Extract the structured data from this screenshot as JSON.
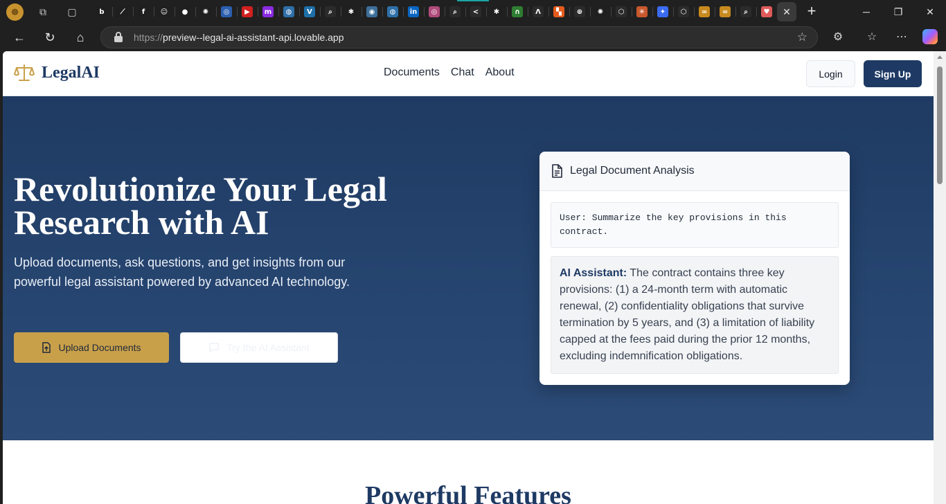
{
  "browser": {
    "url_protocol": "https://",
    "url_host": "preview--legal-ai-assistant-api.lovable.app",
    "tabs": [
      {
        "icon": "b-icon",
        "glyph": "b",
        "color": "#1f1f1f"
      },
      {
        "icon": "trend-icon",
        "glyph": "⟋",
        "color": "#1f1f1f"
      },
      {
        "icon": "f-icon",
        "glyph": "f",
        "color": "#1f1f1f"
      },
      {
        "icon": "robot-icon",
        "glyph": "☺",
        "color": "#1f1f1f"
      },
      {
        "icon": "github-icon",
        "glyph": "●",
        "color": "#1f1f1f"
      },
      {
        "icon": "openai-icon",
        "glyph": "✺",
        "color": "#1f1f1f"
      },
      {
        "icon": "blue-circle-icon",
        "glyph": "◎",
        "color": "#2b5fb0"
      },
      {
        "icon": "youtube-icon",
        "glyph": "▶",
        "color": "#d02020"
      },
      {
        "icon": "m-icon",
        "glyph": "m",
        "color": "#8a2be2"
      },
      {
        "icon": "un-icon",
        "glyph": "◍",
        "color": "#2e6fa8"
      },
      {
        "icon": "v-icon",
        "glyph": "V",
        "color": "#1e6fa8"
      },
      {
        "icon": "search-icon",
        "glyph": "⌕",
        "color": "#2b2b2b"
      },
      {
        "icon": "bug-icon",
        "glyph": "✱",
        "color": "#1f1f1f"
      },
      {
        "icon": "globe-icon",
        "glyph": "◉",
        "color": "#3d6f99"
      },
      {
        "icon": "un-icon",
        "glyph": "◍",
        "color": "#2e6fa8"
      },
      {
        "icon": "linkedin-icon",
        "glyph": "in",
        "color": "#0a66c2"
      },
      {
        "icon": "pink-circle-icon",
        "glyph": "◎",
        "color": "#b04a7a"
      },
      {
        "icon": "search-icon",
        "glyph": "⌕",
        "color": "#2b2b2b"
      },
      {
        "icon": "share-icon",
        "glyph": "<",
        "color": "#2b2b2b"
      },
      {
        "icon": "bug-icon",
        "glyph": "✱",
        "color": "#1f1f1f"
      },
      {
        "icon": "arc-icon",
        "glyph": "∩",
        "color": "#2e7d32"
      },
      {
        "icon": "caret-icon",
        "glyph": "Λ",
        "color": "#2b2b2b"
      },
      {
        "icon": "grid-icon",
        "glyph": "▚",
        "color": "#e55b1c"
      },
      {
        "icon": "web-icon",
        "glyph": "⊕",
        "color": "#2b2b2b"
      },
      {
        "icon": "openai-icon",
        "glyph": "✺",
        "color": "#1f1f1f"
      },
      {
        "icon": "box-icon",
        "glyph": "⬡",
        "color": "#2b2b2b"
      },
      {
        "icon": "claude-icon",
        "glyph": "✳",
        "color": "#c8582d"
      },
      {
        "icon": "gemini-icon",
        "glyph": "✦",
        "color": "#3b6cf0"
      },
      {
        "icon": "box-icon",
        "glyph": "⬡",
        "color": "#2b2b2b"
      },
      {
        "icon": "infinity-icon",
        "glyph": "∞",
        "color": "#c78a1e"
      },
      {
        "icon": "infinity-icon",
        "glyph": "∞",
        "color": "#c78a1e"
      },
      {
        "icon": "search-icon",
        "glyph": "⌕",
        "color": "#2b2b2b"
      },
      {
        "icon": "heart-icon",
        "glyph": "♥",
        "color": "#e05a5a"
      }
    ]
  },
  "site": {
    "logo_text": "LegalAI",
    "nav": [
      "Documents",
      "Chat",
      "About"
    ],
    "login_label": "Login",
    "signup_label": "Sign Up"
  },
  "hero": {
    "title_line1": "Revolutionize Your Legal",
    "title_line2": "Research with AI",
    "subtitle": "Upload documents, ask questions, and get insights from our powerful legal assistant powered by advanced AI technology.",
    "upload_label": "Upload Documents",
    "try_label": "Try the AI Assistant"
  },
  "card": {
    "title": "Legal Document Analysis",
    "user_message": "User: Summarize the key provisions in this contract.",
    "ai_label": "AI Assistant:",
    "ai_message": "The contract contains three key provisions: (1) a 24-month term with automatic renewal, (2) confidentiality obligations that survive termination by 5 years, and (3) a limitation of liability capped at the fees paid during the prior 12 months, excluding indemnification obligations."
  },
  "features": {
    "title": "Powerful Features"
  },
  "colors": {
    "brand_navy": "#1e3a64",
    "accent_gold": "#c9a04a"
  }
}
